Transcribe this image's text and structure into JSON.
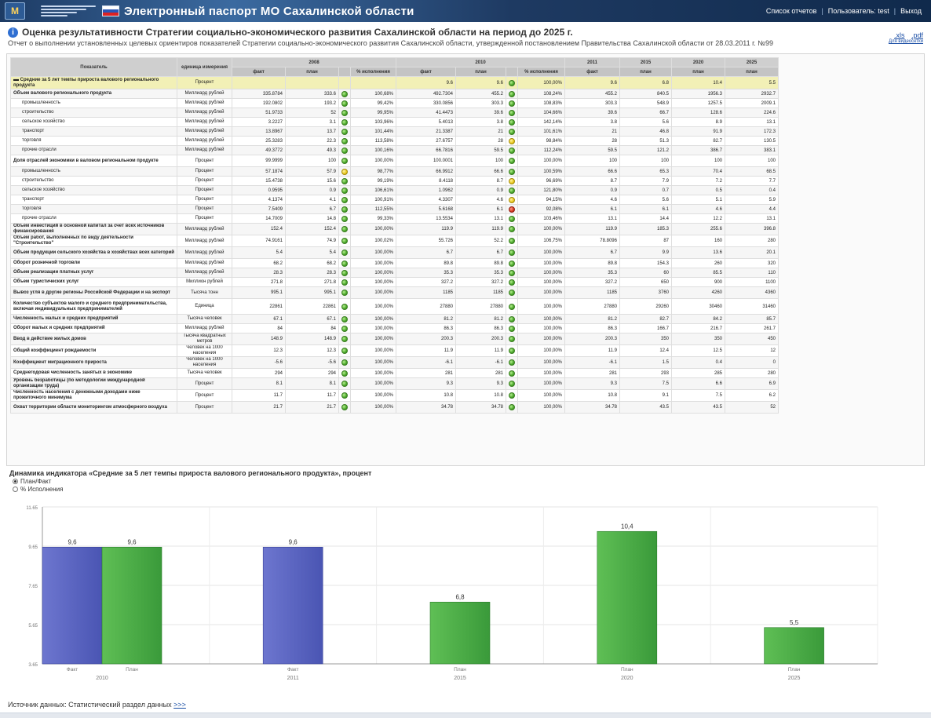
{
  "header": {
    "title": "Электронный паспорт МО Сахалинской области",
    "reports_link": "Список отчетов",
    "user_label": "Пользователь: test",
    "logout": "Выход",
    "logo_glyph": "М"
  },
  "page": {
    "title": "Оценка результативности Стратегии социально-экономического развития Сахалинской области на период до 2025 г.",
    "subtitle": "Отчет о выполнении установленных целевых ориентиров показателей Стратегии социально-экономического развития Сахалинской области, утвержденной постановлением Правительства Сахалинской области от 28.03.2011 г. №99",
    "export_xls": ".xls",
    "export_pdf": ".pdf",
    "export_note": "Для видеосетки"
  },
  "table": {
    "headers": {
      "indicator": "Показатель",
      "unit": "единица измерения",
      "y2008": "2008",
      "y2010": "2010",
      "y2011": "2011",
      "y2015": "2015",
      "y2020": "2020",
      "y2025": "2025",
      "fact": "факт",
      "plan": "план",
      "pct": "% исполнения"
    },
    "rows": [
      {
        "name": "Средние за 5 лет темпы прироста валового регионального продукта",
        "unit": "Процент",
        "style": "hl",
        "f08": "",
        "p08": "",
        "d08": "",
        "pc08": "",
        "f10": "9.6",
        "p10": "9.6",
        "d10": "g",
        "pc10": "100,00%",
        "v11": "9.6",
        "v15": "6.8",
        "v20": "10.4",
        "v25": "5.5",
        "toggle": "▬"
      },
      {
        "name": "Объем валового регионального продукта",
        "unit": "Миллиард рублей",
        "style": "bold",
        "f08": "335.8784",
        "p08": "333.6",
        "d08": "g",
        "pc08": "100,68%",
        "f10": "492.7304",
        "p10": "455.2",
        "d10": "g",
        "pc10": "108,24%",
        "v11": "455.2",
        "v15": "840.5",
        "v20": "1956.3",
        "v25": "2932.7"
      },
      {
        "name": "промышленность",
        "unit": "Миллиард рублей",
        "style": "ind",
        "f08": "192.0802",
        "p08": "193.2",
        "d08": "g",
        "pc08": "99,42%",
        "f10": "330.0856",
        "p10": "303.3",
        "d10": "g",
        "pc10": "108,83%",
        "v11": "303.3",
        "v15": "548.9",
        "v20": "1257.5",
        "v25": "2009.1"
      },
      {
        "name": "строительство",
        "unit": "Миллиард рублей",
        "style": "ind",
        "f08": "51.9733",
        "p08": "52",
        "d08": "g",
        "pc08": "99,95%",
        "f10": "41.4473",
        "p10": "39.6",
        "d10": "g",
        "pc10": "104,66%",
        "v11": "39.6",
        "v15": "66.7",
        "v20": "128.6",
        "v25": "224.6"
      },
      {
        "name": "сельское хозяйство",
        "unit": "Миллиард рублей",
        "style": "ind",
        "f08": "3.2227",
        "p08": "3.1",
        "d08": "g",
        "pc08": "103,96%",
        "f10": "5.4013",
        "p10": "3.8",
        "d10": "g",
        "pc10": "142,14%",
        "v11": "3.8",
        "v15": "5.6",
        "v20": "8.9",
        "v25": "13.1"
      },
      {
        "name": "транспорт",
        "unit": "Миллиард рублей",
        "style": "ind",
        "f08": "13.8967",
        "p08": "13.7",
        "d08": "g",
        "pc08": "101,44%",
        "f10": "21.3387",
        "p10": "21",
        "d10": "g",
        "pc10": "101,61%",
        "v11": "21",
        "v15": "46.8",
        "v20": "91.9",
        "v25": "172.3"
      },
      {
        "name": "торговля",
        "unit": "Миллиард рублей",
        "style": "ind",
        "f08": "25.3283",
        "p08": "22.3",
        "d08": "g",
        "pc08": "113,58%",
        "f10": "27.6757",
        "p10": "28",
        "d10": "y",
        "pc10": "98,84%",
        "v11": "28",
        "v15": "51.3",
        "v20": "82.7",
        "v25": "130.5"
      },
      {
        "name": "прочие отрасли",
        "unit": "Миллиард рублей",
        "style": "ind",
        "f08": "49.3772",
        "p08": "49.3",
        "d08": "g",
        "pc08": "100,16%",
        "f10": "66.7816",
        "p10": "59.5",
        "d10": "g",
        "pc10": "112,24%",
        "v11": "59.5",
        "v15": "121.2",
        "v20": "386.7",
        "v25": "383.1"
      },
      {
        "name": "Доля отраслей экономики в валовом региональном продукте",
        "unit": "Процент",
        "style": "bold",
        "f08": "99.9999",
        "p08": "100",
        "d08": "g",
        "pc08": "100,00%",
        "f10": "100.0001",
        "p10": "100",
        "d10": "g",
        "pc10": "100,00%",
        "v11": "100",
        "v15": "100",
        "v20": "100",
        "v25": "100"
      },
      {
        "name": "промышленность",
        "unit": "Процент",
        "style": "ind",
        "f08": "57.1874",
        "p08": "57.9",
        "d08": "y",
        "pc08": "98,77%",
        "f10": "66.9912",
        "p10": "66.6",
        "d10": "g",
        "pc10": "100,59%",
        "v11": "66.6",
        "v15": "65.3",
        "v20": "70.4",
        "v25": "68.5"
      },
      {
        "name": "строительство",
        "unit": "Процент",
        "style": "ind",
        "f08": "15.4738",
        "p08": "15.6",
        "d08": "g",
        "pc08": "99,19%",
        "f10": "8.4118",
        "p10": "8.7",
        "d10": "y",
        "pc10": "96,69%",
        "v11": "8.7",
        "v15": "7.9",
        "v20": "7.2",
        "v25": "7.7"
      },
      {
        "name": "сельское хозяйство",
        "unit": "Процент",
        "style": "ind",
        "f08": "0.9595",
        "p08": "0.9",
        "d08": "g",
        "pc08": "106,61%",
        "f10": "1.0962",
        "p10": "0.9",
        "d10": "g",
        "pc10": "121,80%",
        "v11": "0.9",
        "v15": "0.7",
        "v20": "0.5",
        "v25": "0.4"
      },
      {
        "name": "транспорт",
        "unit": "Процент",
        "style": "ind",
        "f08": "4.1374",
        "p08": "4.1",
        "d08": "g",
        "pc08": "100,91%",
        "f10": "4.3307",
        "p10": "4.6",
        "d10": "y",
        "pc10": "94,15%",
        "v11": "4.6",
        "v15": "5.6",
        "v20": "5.1",
        "v25": "5.9"
      },
      {
        "name": "торговля",
        "unit": "Процент",
        "style": "ind",
        "f08": "7.5409",
        "p08": "6.7",
        "d08": "g",
        "pc08": "112,55%",
        "f10": "5.6168",
        "p10": "6.1",
        "d10": "r",
        "pc10": "92,08%",
        "v11": "6.1",
        "v15": "6.1",
        "v20": "4.6",
        "v25": "4.4"
      },
      {
        "name": "прочие отрасли",
        "unit": "Процент",
        "style": "ind",
        "f08": "14.7009",
        "p08": "14.8",
        "d08": "g",
        "pc08": "99,33%",
        "f10": "13.5534",
        "p10": "13.1",
        "d10": "g",
        "pc10": "103,46%",
        "v11": "13.1",
        "v15": "14.4",
        "v20": "12.2",
        "v25": "13.1"
      },
      {
        "name": "Объем инвестиций в основной капитал за счет всех источников финансирования",
        "unit": "Миллиард рублей",
        "style": "bold",
        "f08": "152.4",
        "p08": "152.4",
        "d08": "g",
        "pc08": "100,00%",
        "f10": "119.9",
        "p10": "119.9",
        "d10": "g",
        "pc10": "100,00%",
        "v11": "119.9",
        "v15": "185.3",
        "v20": "255.6",
        "v25": "396.8"
      },
      {
        "name": "Объем работ, выполненных по виду деятельности \"Строительство\"",
        "unit": "Миллиард рублей",
        "style": "bold",
        "f08": "74.9161",
        "p08": "74.9",
        "d08": "g",
        "pc08": "100,02%",
        "f10": "55.726",
        "p10": "52.2",
        "d10": "g",
        "pc10": "106,75%",
        "v11": "78.8096",
        "v15": "87",
        "v20": "160",
        "v25": "280"
      },
      {
        "name": "Объем продукции сельского хозяйства в хозяйствах всех категорий",
        "unit": "Миллиард рублей",
        "style": "bold",
        "f08": "5.4",
        "p08": "5.4",
        "d08": "g",
        "pc08": "100,00%",
        "f10": "6.7",
        "p10": "6.7",
        "d10": "g",
        "pc10": "100,00%",
        "v11": "6.7",
        "v15": "9.9",
        "v20": "13.6",
        "v25": "20.1"
      },
      {
        "name": "Оборот розничной торговли",
        "unit": "Миллиард рублей",
        "style": "bold",
        "f08": "68.2",
        "p08": "68.2",
        "d08": "g",
        "pc08": "100,00%",
        "f10": "89.8",
        "p10": "89.8",
        "d10": "g",
        "pc10": "100,00%",
        "v11": "89.8",
        "v15": "154.3",
        "v20": "260",
        "v25": "320"
      },
      {
        "name": "Объем реализации платных услуг",
        "unit": "Миллиард рублей",
        "style": "bold",
        "f08": "28.3",
        "p08": "28.3",
        "d08": "g",
        "pc08": "100,00%",
        "f10": "35.3",
        "p10": "35.3",
        "d10": "g",
        "pc10": "100,00%",
        "v11": "35.3",
        "v15": "60",
        "v20": "85.5",
        "v25": "110"
      },
      {
        "name": "Объем туристических услуг",
        "unit": "Миллион рублей",
        "style": "bold",
        "f08": "271.8",
        "p08": "271.8",
        "d08": "g",
        "pc08": "100,00%",
        "f10": "327.2",
        "p10": "327.2",
        "d10": "g",
        "pc10": "100,00%",
        "v11": "327.2",
        "v15": "650",
        "v20": "900",
        "v25": "1100"
      },
      {
        "name": "Вывоз угля в другие регионы Российской Федерации и на экспорт",
        "unit": "Тысяча тонн",
        "style": "bold",
        "f08": "995.1",
        "p08": "995.1",
        "d08": "g",
        "pc08": "100,00%",
        "f10": "1185",
        "p10": "1185",
        "d10": "g",
        "pc10": "100,00%",
        "v11": "1185",
        "v15": "3760",
        "v20": "4260",
        "v25": "4360"
      },
      {
        "name": "Количество субъектов малого и среднего предпринимательства, включая индивидуальных предпринимателей",
        "unit": "Единица",
        "style": "bold",
        "f08": "22861",
        "p08": "22861",
        "d08": "g",
        "pc08": "100,00%",
        "f10": "27880",
        "p10": "27880",
        "d10": "g",
        "pc10": "100,00%",
        "v11": "27880",
        "v15": "29260",
        "v20": "30460",
        "v25": "31460"
      },
      {
        "name": "Численность малых и средних предприятий",
        "unit": "Тысяча человек",
        "style": "bold",
        "f08": "67.1",
        "p08": "67.1",
        "d08": "g",
        "pc08": "100,00%",
        "f10": "81.2",
        "p10": "81.2",
        "d10": "g",
        "pc10": "100,00%",
        "v11": "81.2",
        "v15": "82.7",
        "v20": "84.2",
        "v25": "85.7"
      },
      {
        "name": "Оборот малых и средних предприятий",
        "unit": "Миллиард рублей",
        "style": "bold",
        "f08": "84",
        "p08": "84",
        "d08": "g",
        "pc08": "100,00%",
        "f10": "86.3",
        "p10": "86.3",
        "d10": "g",
        "pc10": "100,00%",
        "v11": "86.3",
        "v15": "166.7",
        "v20": "216.7",
        "v25": "261.7"
      },
      {
        "name": "Ввод в действие жилых домов",
        "unit": "Тысяча квадратных метров",
        "style": "bold",
        "f08": "148.9",
        "p08": "148.9",
        "d08": "g",
        "pc08": "100,00%",
        "f10": "200.3",
        "p10": "200.3",
        "d10": "g",
        "pc10": "100,00%",
        "v11": "200.3",
        "v15": "350",
        "v20": "350",
        "v25": "450"
      },
      {
        "name": "Общий коэффициент рождаемости",
        "unit": "Человек на 1000 населения",
        "style": "bold",
        "f08": "12.3",
        "p08": "12.3",
        "d08": "g",
        "pc08": "100,00%",
        "f10": "11.9",
        "p10": "11.9",
        "d10": "g",
        "pc10": "100,00%",
        "v11": "11.9",
        "v15": "12.4",
        "v20": "12.5",
        "v25": "12"
      },
      {
        "name": "Коэффициент миграционного прироста",
        "unit": "Человек на 1000 населения",
        "style": "bold",
        "f08": "-5.6",
        "p08": "-5.6",
        "d08": "g",
        "pc08": "100,00%",
        "f10": "-6.1",
        "p10": "-6.1",
        "d10": "g",
        "pc10": "100,00%",
        "v11": "-6.1",
        "v15": "1.5",
        "v20": "0.4",
        "v25": "0"
      },
      {
        "name": "Среднегодовая численность занятых в экономике",
        "unit": "Тысяча человек",
        "style": "bold",
        "f08": "294",
        "p08": "294",
        "d08": "g",
        "pc08": "100,00%",
        "f10": "281",
        "p10": "281",
        "d10": "g",
        "pc10": "100,00%",
        "v11": "281",
        "v15": "293",
        "v20": "285",
        "v25": "280"
      },
      {
        "name": "Уровень безработицы (по методологии международной организации труда)",
        "unit": "Процент",
        "style": "bold",
        "f08": "8.1",
        "p08": "8.1",
        "d08": "g",
        "pc08": "100,00%",
        "f10": "9.3",
        "p10": "9.3",
        "d10": "g",
        "pc10": "100,00%",
        "v11": "9.3",
        "v15": "7.5",
        "v20": "6.6",
        "v25": "6.9"
      },
      {
        "name": "Численность населения с денежными доходами ниже прожиточного минимума",
        "unit": "Процент",
        "style": "bold",
        "f08": "11.7",
        "p08": "11.7",
        "d08": "g",
        "pc08": "100,00%",
        "f10": "10.8",
        "p10": "10.8",
        "d10": "g",
        "pc10": "100,00%",
        "v11": "10.8",
        "v15": "9.1",
        "v20": "7.5",
        "v25": "6.2"
      },
      {
        "name": "Охват территории области мониторингом атмосферного воздуха",
        "unit": "Процент",
        "style": "bold",
        "f08": "21.7",
        "p08": "21.7",
        "d08": "g",
        "pc08": "100,00%",
        "f10": "34.78",
        "p10": "34.78",
        "d10": "g",
        "pc10": "100,00%",
        "v11": "34.78",
        "v15": "43.5",
        "v20": "43.5",
        "v25": "52"
      }
    ]
  },
  "chart_section": {
    "title": "Динамика индикатора «Средние за 5 лет темпы прироста валового регионального продукта», процент",
    "radio_plan_fact": "План/Факт",
    "radio_pct": "% Исполнения"
  },
  "chart_data": {
    "type": "bar",
    "ylim": [
      3.65,
      11.65
    ],
    "yticks": [
      "11.65",
      "9.65",
      "7.65",
      "5.65",
      "3.65"
    ],
    "grid": true,
    "colors": {
      "fact": "#4a55b3",
      "plan": "#3a9a3a"
    },
    "groups": [
      {
        "year": "2010",
        "bars": [
          {
            "label": "Факт",
            "value": 9.6,
            "value_label": "9,6",
            "kind": "fact"
          },
          {
            "label": "План",
            "value": 9.6,
            "value_label": "9,6",
            "kind": "plan"
          }
        ]
      },
      {
        "year": "2011",
        "bars": [
          {
            "label": "Факт",
            "value": 9.6,
            "value_label": "9,6",
            "kind": "fact"
          }
        ]
      },
      {
        "year": "2015",
        "bars": [
          {
            "label": "План",
            "value": 6.8,
            "value_label": "6,8",
            "kind": "plan"
          }
        ]
      },
      {
        "year": "2020",
        "bars": [
          {
            "label": "План",
            "value": 10.4,
            "value_label": "10,4",
            "kind": "plan"
          }
        ]
      },
      {
        "year": "2025",
        "bars": [
          {
            "label": "План",
            "value": 5.5,
            "value_label": "5,5",
            "kind": "plan"
          }
        ]
      }
    ]
  },
  "footer": {
    "source_label": "Источник данных: Статистический раздел данных",
    "source_link": ">>>"
  }
}
